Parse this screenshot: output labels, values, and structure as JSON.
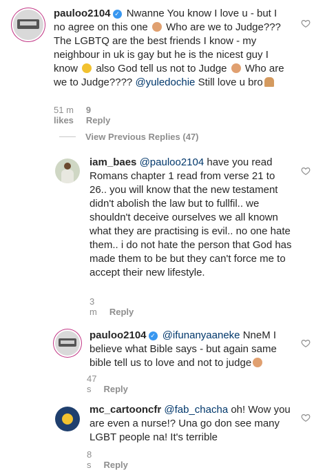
{
  "comments": [
    {
      "username": "pauloo2104",
      "verified": true,
      "parts": [
        "Nwanne You know I love u - but I no agree on this one",
        "Who are we to Judge??? The LGBTQ are the best friends I know - my neighbour in uk is gay but he is the nicest guy I know",
        "also God tell us not to Judge",
        "Who are we to Judge????",
        "@yuledochie",
        "Still love u bro"
      ],
      "time": "51 m",
      "likes": "9 likes",
      "reply": "Reply"
    },
    {
      "username": "iam_baes",
      "mention": "@pauloo2104",
      "text": "have you read Romans chapter 1 read from verse 21 to 26.. you will know that the new testament didn't abolish the law but to fullfil.. we shouldn't deceive ourselves we all known what they are practising is evil.. no one hate them.. i do not hate the person that God has made them to be but they can't force me to accept their new lifestyle.",
      "time": "3 m",
      "reply": "Reply"
    },
    {
      "username": "pauloo2104",
      "verified": true,
      "mention": "@ifunanyaaneke",
      "text": "NneM I believe what Bible says - but again same bible tell us to love and not to judge",
      "time": "47 s",
      "reply": "Reply"
    },
    {
      "username": "mc_cartooncfr",
      "mention": "@fab_chacha",
      "text": "oh! Wow you are even a nurse!? Una go don see many LGBT people na! It's terrible",
      "time": "8 s",
      "reply": "Reply"
    }
  ],
  "view_previous": "View Previous Replies (47)",
  "icons": {
    "heart": "heart-outline-icon",
    "verified": "verified-badge-icon"
  },
  "colors": {
    "text": "#262626",
    "muted": "#8e8e8e",
    "link": "#00376b",
    "verified": "#3897f0"
  }
}
